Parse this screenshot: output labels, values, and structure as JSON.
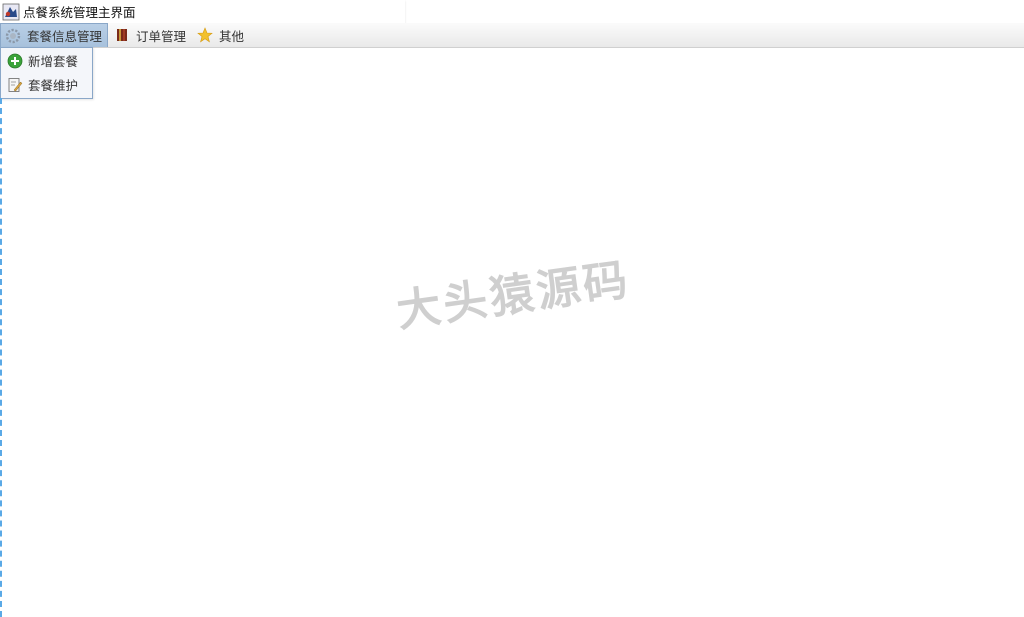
{
  "window": {
    "title": "点餐系统管理主界面",
    "icon": "java-app-icon"
  },
  "menubar": {
    "menus": [
      {
        "label": "套餐信息管理",
        "icon": "gear-icon",
        "active": true
      },
      {
        "label": "订单管理",
        "icon": "book-icon"
      },
      {
        "label": "其他",
        "icon": "star-icon"
      }
    ]
  },
  "dropdown": {
    "items": [
      {
        "label": "新增套餐",
        "icon": "add-circle-icon"
      },
      {
        "label": "套餐维护",
        "icon": "edit-document-icon"
      }
    ]
  },
  "watermark": {
    "text": "大头猿源码"
  },
  "colors": {
    "menu_active": "#a7c1dc",
    "dropdown_border": "#8aa7c8",
    "edge_dashed": "#5aa9e6",
    "watermark": "#cfcfcf"
  }
}
